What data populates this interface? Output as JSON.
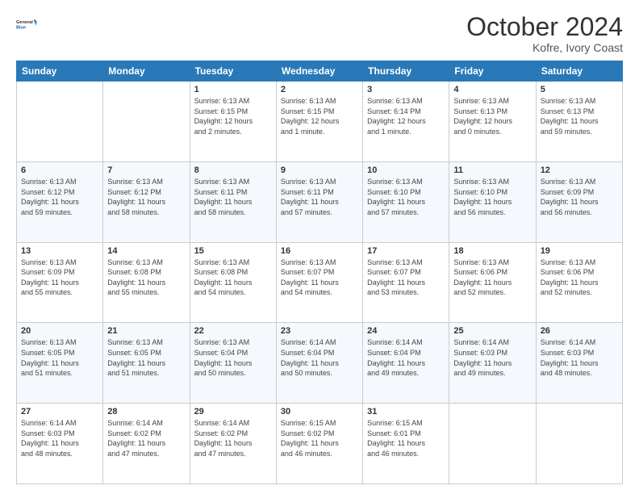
{
  "header": {
    "logo_general": "General",
    "logo_blue": "Blue",
    "month_title": "October 2024",
    "location": "Kofre, Ivory Coast"
  },
  "days_of_week": [
    "Sunday",
    "Monday",
    "Tuesday",
    "Wednesday",
    "Thursday",
    "Friday",
    "Saturday"
  ],
  "weeks": [
    [
      {
        "day": "",
        "info": ""
      },
      {
        "day": "",
        "info": ""
      },
      {
        "day": "1",
        "info": "Sunrise: 6:13 AM\nSunset: 6:15 PM\nDaylight: 12 hours\nand 2 minutes."
      },
      {
        "day": "2",
        "info": "Sunrise: 6:13 AM\nSunset: 6:15 PM\nDaylight: 12 hours\nand 1 minute."
      },
      {
        "day": "3",
        "info": "Sunrise: 6:13 AM\nSunset: 6:14 PM\nDaylight: 12 hours\nand 1 minute."
      },
      {
        "day": "4",
        "info": "Sunrise: 6:13 AM\nSunset: 6:13 PM\nDaylight: 12 hours\nand 0 minutes."
      },
      {
        "day": "5",
        "info": "Sunrise: 6:13 AM\nSunset: 6:13 PM\nDaylight: 11 hours\nand 59 minutes."
      }
    ],
    [
      {
        "day": "6",
        "info": "Sunrise: 6:13 AM\nSunset: 6:12 PM\nDaylight: 11 hours\nand 59 minutes."
      },
      {
        "day": "7",
        "info": "Sunrise: 6:13 AM\nSunset: 6:12 PM\nDaylight: 11 hours\nand 58 minutes."
      },
      {
        "day": "8",
        "info": "Sunrise: 6:13 AM\nSunset: 6:11 PM\nDaylight: 11 hours\nand 58 minutes."
      },
      {
        "day": "9",
        "info": "Sunrise: 6:13 AM\nSunset: 6:11 PM\nDaylight: 11 hours\nand 57 minutes."
      },
      {
        "day": "10",
        "info": "Sunrise: 6:13 AM\nSunset: 6:10 PM\nDaylight: 11 hours\nand 57 minutes."
      },
      {
        "day": "11",
        "info": "Sunrise: 6:13 AM\nSunset: 6:10 PM\nDaylight: 11 hours\nand 56 minutes."
      },
      {
        "day": "12",
        "info": "Sunrise: 6:13 AM\nSunset: 6:09 PM\nDaylight: 11 hours\nand 56 minutes."
      }
    ],
    [
      {
        "day": "13",
        "info": "Sunrise: 6:13 AM\nSunset: 6:09 PM\nDaylight: 11 hours\nand 55 minutes."
      },
      {
        "day": "14",
        "info": "Sunrise: 6:13 AM\nSunset: 6:08 PM\nDaylight: 11 hours\nand 55 minutes."
      },
      {
        "day": "15",
        "info": "Sunrise: 6:13 AM\nSunset: 6:08 PM\nDaylight: 11 hours\nand 54 minutes."
      },
      {
        "day": "16",
        "info": "Sunrise: 6:13 AM\nSunset: 6:07 PM\nDaylight: 11 hours\nand 54 minutes."
      },
      {
        "day": "17",
        "info": "Sunrise: 6:13 AM\nSunset: 6:07 PM\nDaylight: 11 hours\nand 53 minutes."
      },
      {
        "day": "18",
        "info": "Sunrise: 6:13 AM\nSunset: 6:06 PM\nDaylight: 11 hours\nand 52 minutes."
      },
      {
        "day": "19",
        "info": "Sunrise: 6:13 AM\nSunset: 6:06 PM\nDaylight: 11 hours\nand 52 minutes."
      }
    ],
    [
      {
        "day": "20",
        "info": "Sunrise: 6:13 AM\nSunset: 6:05 PM\nDaylight: 11 hours\nand 51 minutes."
      },
      {
        "day": "21",
        "info": "Sunrise: 6:13 AM\nSunset: 6:05 PM\nDaylight: 11 hours\nand 51 minutes."
      },
      {
        "day": "22",
        "info": "Sunrise: 6:13 AM\nSunset: 6:04 PM\nDaylight: 11 hours\nand 50 minutes."
      },
      {
        "day": "23",
        "info": "Sunrise: 6:14 AM\nSunset: 6:04 PM\nDaylight: 11 hours\nand 50 minutes."
      },
      {
        "day": "24",
        "info": "Sunrise: 6:14 AM\nSunset: 6:04 PM\nDaylight: 11 hours\nand 49 minutes."
      },
      {
        "day": "25",
        "info": "Sunrise: 6:14 AM\nSunset: 6:03 PM\nDaylight: 11 hours\nand 49 minutes."
      },
      {
        "day": "26",
        "info": "Sunrise: 6:14 AM\nSunset: 6:03 PM\nDaylight: 11 hours\nand 48 minutes."
      }
    ],
    [
      {
        "day": "27",
        "info": "Sunrise: 6:14 AM\nSunset: 6:03 PM\nDaylight: 11 hours\nand 48 minutes."
      },
      {
        "day": "28",
        "info": "Sunrise: 6:14 AM\nSunset: 6:02 PM\nDaylight: 11 hours\nand 47 minutes."
      },
      {
        "day": "29",
        "info": "Sunrise: 6:14 AM\nSunset: 6:02 PM\nDaylight: 11 hours\nand 47 minutes."
      },
      {
        "day": "30",
        "info": "Sunrise: 6:15 AM\nSunset: 6:02 PM\nDaylight: 11 hours\nand 46 minutes."
      },
      {
        "day": "31",
        "info": "Sunrise: 6:15 AM\nSunset: 6:01 PM\nDaylight: 11 hours\nand 46 minutes."
      },
      {
        "day": "",
        "info": ""
      },
      {
        "day": "",
        "info": ""
      }
    ]
  ]
}
